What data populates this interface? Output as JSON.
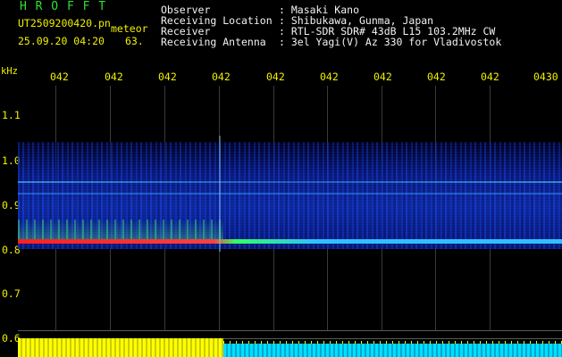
{
  "header": {
    "app_name": "H R O F F T",
    "filename": "UT2509200420.pn",
    "mode": "meteor",
    "datetime": "25.09.20 04:20",
    "count": "63.",
    "fields": [
      {
        "label": "Observer",
        "value": ": Masaki Kano"
      },
      {
        "label": "Receiving Location",
        "value": ": Shibukawa, Gunma, Japan"
      },
      {
        "label": "Receiver",
        "value": ": RTL-SDR SDR# 43dB L15 103.2MHz CW"
      },
      {
        "label": "Receiving Antenna",
        "value": ": 3el Yagi(V) Az 330 for Vladivostok"
      }
    ]
  },
  "axes": {
    "y_unit": "kHz",
    "y_ticks": [
      "1.1",
      "1.0",
      "0.9",
      "0.8",
      "0.7",
      "0.6"
    ],
    "x_ticks": [
      "042",
      "042",
      "042",
      "042",
      "042",
      "042",
      "042",
      "042",
      "042",
      "0430"
    ]
  },
  "colors": {
    "header_title": "#2fe02f",
    "header_text": "#f0f000",
    "field_text": "#f2f2f2",
    "signal_strong": "#ff2020",
    "signal_medium": "#30ff60",
    "noise_blue": "#1030d0",
    "baseline_yellow": "#ffff00",
    "baseline_cyan": "#00e0ff"
  }
}
